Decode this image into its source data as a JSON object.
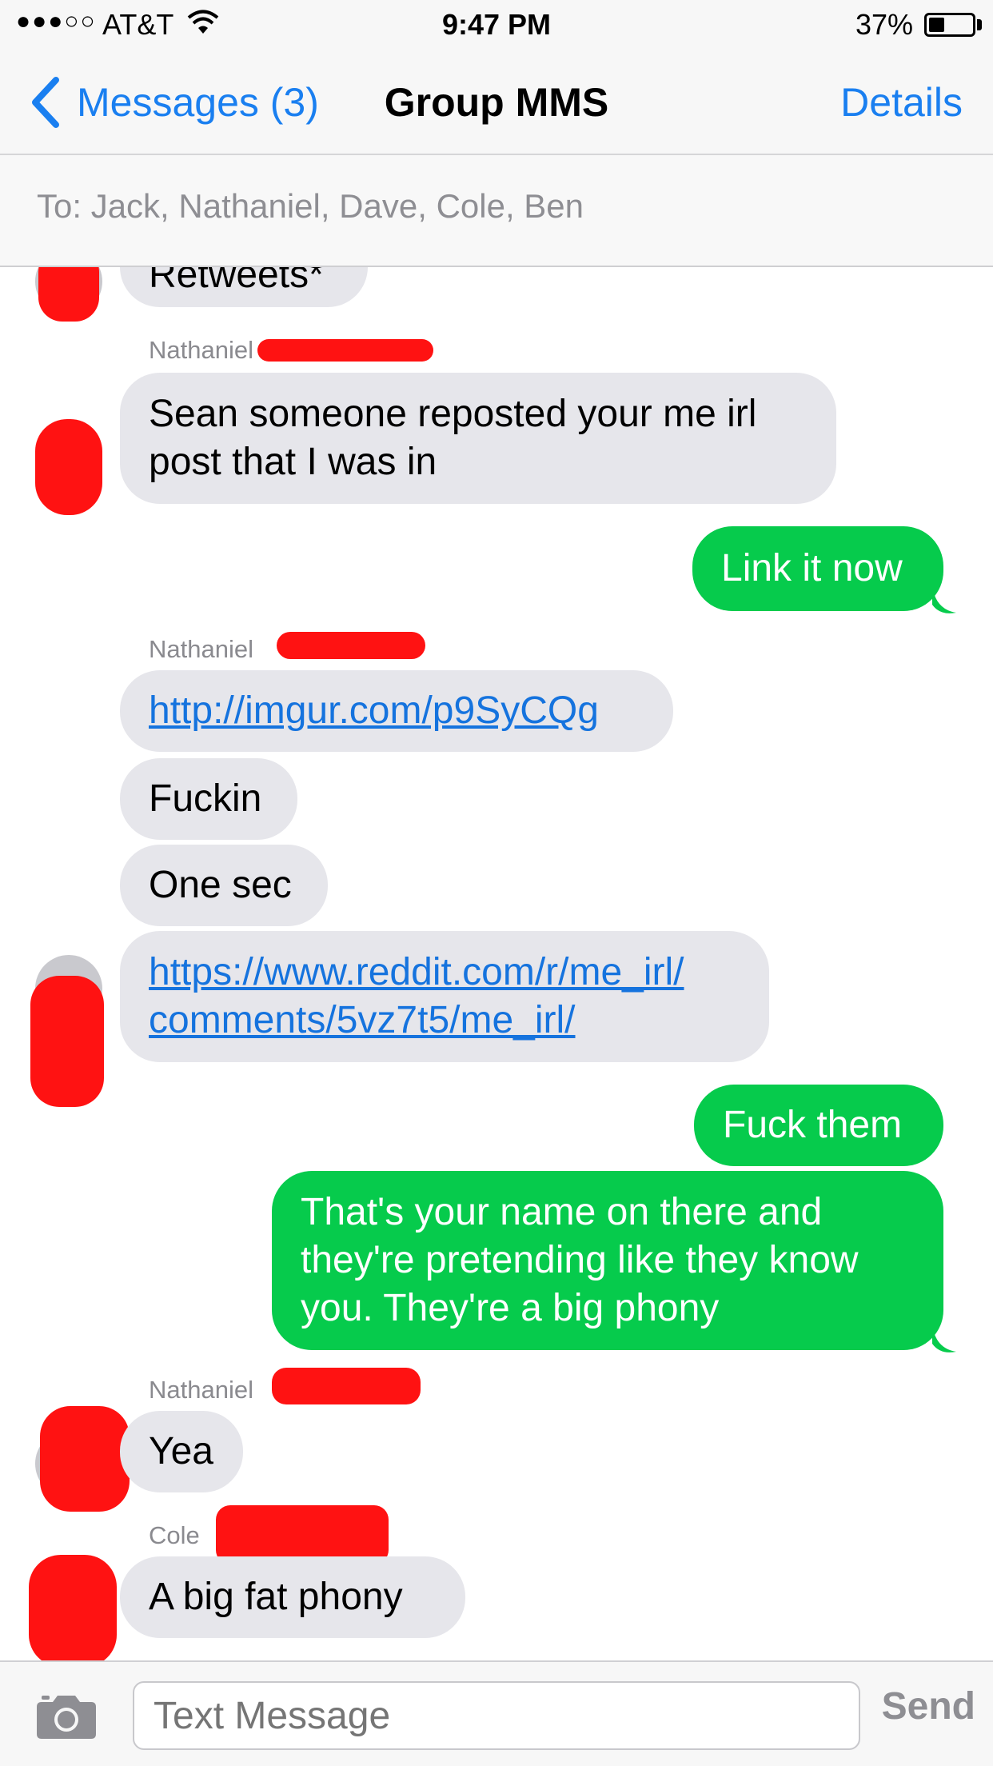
{
  "status_bar": {
    "signal": "●●●○○",
    "carrier": "AT&T",
    "time": "9:47 PM",
    "battery_percent": "37%",
    "battery_level": 0.37
  },
  "nav": {
    "back_label": "Messages (3)",
    "title": "Group MMS",
    "details_label": "Details"
  },
  "recipients": "To: Jack, Nathaniel, Dave, Cole, Ben",
  "messages": [
    {
      "direction": "in",
      "text": "Retweets*"
    },
    {
      "direction": "in",
      "sender": "Nathaniel",
      "text": "Sean someone reposted your me irl post that I was in"
    },
    {
      "direction": "out",
      "text": "Link it now"
    },
    {
      "direction": "in",
      "sender": "Nathaniel",
      "text": "http://imgur.com/p9SyCQg",
      "is_link": true
    },
    {
      "direction": "in",
      "text": "Fuckin"
    },
    {
      "direction": "in",
      "text": "One sec"
    },
    {
      "direction": "in",
      "text_line1": "https://www.reddit.com/r/me_irl/",
      "text_line2": "comments/5vz7t5/me_irl/",
      "is_link": true
    },
    {
      "direction": "out",
      "text": "Fuck them"
    },
    {
      "direction": "out",
      "text_line1": "That's your name on there and",
      "text_line2": "they're pretending like they know",
      "text_line3": "you. They're a big phony"
    },
    {
      "direction": "in",
      "sender": "Nathaniel",
      "text": "Yea"
    },
    {
      "direction": "in",
      "sender": "Cole",
      "text": "A big fat phony"
    }
  ],
  "input": {
    "placeholder": "Text Message",
    "send_label": "Send"
  },
  "colors": {
    "ios_blue": "#1a7ff0",
    "outgoing_bubble": "#06cb4c",
    "incoming_bubble": "#e6e6eb",
    "redaction": "#ff1212"
  }
}
